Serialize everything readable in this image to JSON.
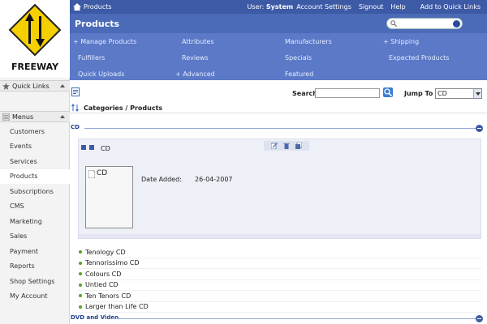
{
  "sidebar": {
    "logo_text": "FREEWAY",
    "quick_links": "Quick Links",
    "menus": "Menus",
    "items": [
      {
        "label": "Customers"
      },
      {
        "label": "Events"
      },
      {
        "label": "Services"
      },
      {
        "label": "Products"
      },
      {
        "label": "Subscriptions"
      },
      {
        "label": "CMS"
      },
      {
        "label": "Marketing"
      },
      {
        "label": "Sales"
      },
      {
        "label": "Payment"
      },
      {
        "label": "Reports"
      },
      {
        "label": "Shop Settings"
      },
      {
        "label": "My Account"
      }
    ],
    "active_item": "Products"
  },
  "topbar": {
    "breadcrumb": "Products",
    "user_prefix": "User:",
    "user_name": "System",
    "account_settings": "Account Settings",
    "signout": "Signout",
    "help": "Help",
    "add_quick": "Add to Quick Links"
  },
  "header": {
    "title": "Products",
    "search_placeholder": ""
  },
  "nav": {
    "manage_products": "+ Manage Products",
    "attributes": "Attributes",
    "manufacturers": "Manufacturers",
    "shipping": "+ Shipping",
    "fulfillers": "Fulfillers",
    "reviews": "Reviews",
    "specials": "Specials",
    "expected_products": "Expected Products",
    "quick_uploads": "Quick Uploads",
    "advanced": "+ Advanced",
    "featured": "Featured"
  },
  "toolbar": {
    "search_label": "Search",
    "search_value": "",
    "jump_label": "Jump To",
    "jump_value": "CD"
  },
  "categories": {
    "title": "Categories / Products"
  },
  "sections": {
    "cd": "CD",
    "dvd": "DVD and Video"
  },
  "product": {
    "name": "CD",
    "image_label": "CD",
    "date_label": "Date Added:",
    "date_value": "26-04-2007"
  },
  "sublist": [
    {
      "label": "Tenology CD"
    },
    {
      "label": "Tennorissimo CD"
    },
    {
      "label": "Colours CD"
    },
    {
      "label": "Untied CD"
    },
    {
      "label": "Ten Tenors CD"
    },
    {
      "label": "Larger than Life CD"
    }
  ],
  "colors": {
    "topbar": "#3d5aa6",
    "navmenu": "#5b79c7",
    "logo_yellow": "#f5d000"
  }
}
